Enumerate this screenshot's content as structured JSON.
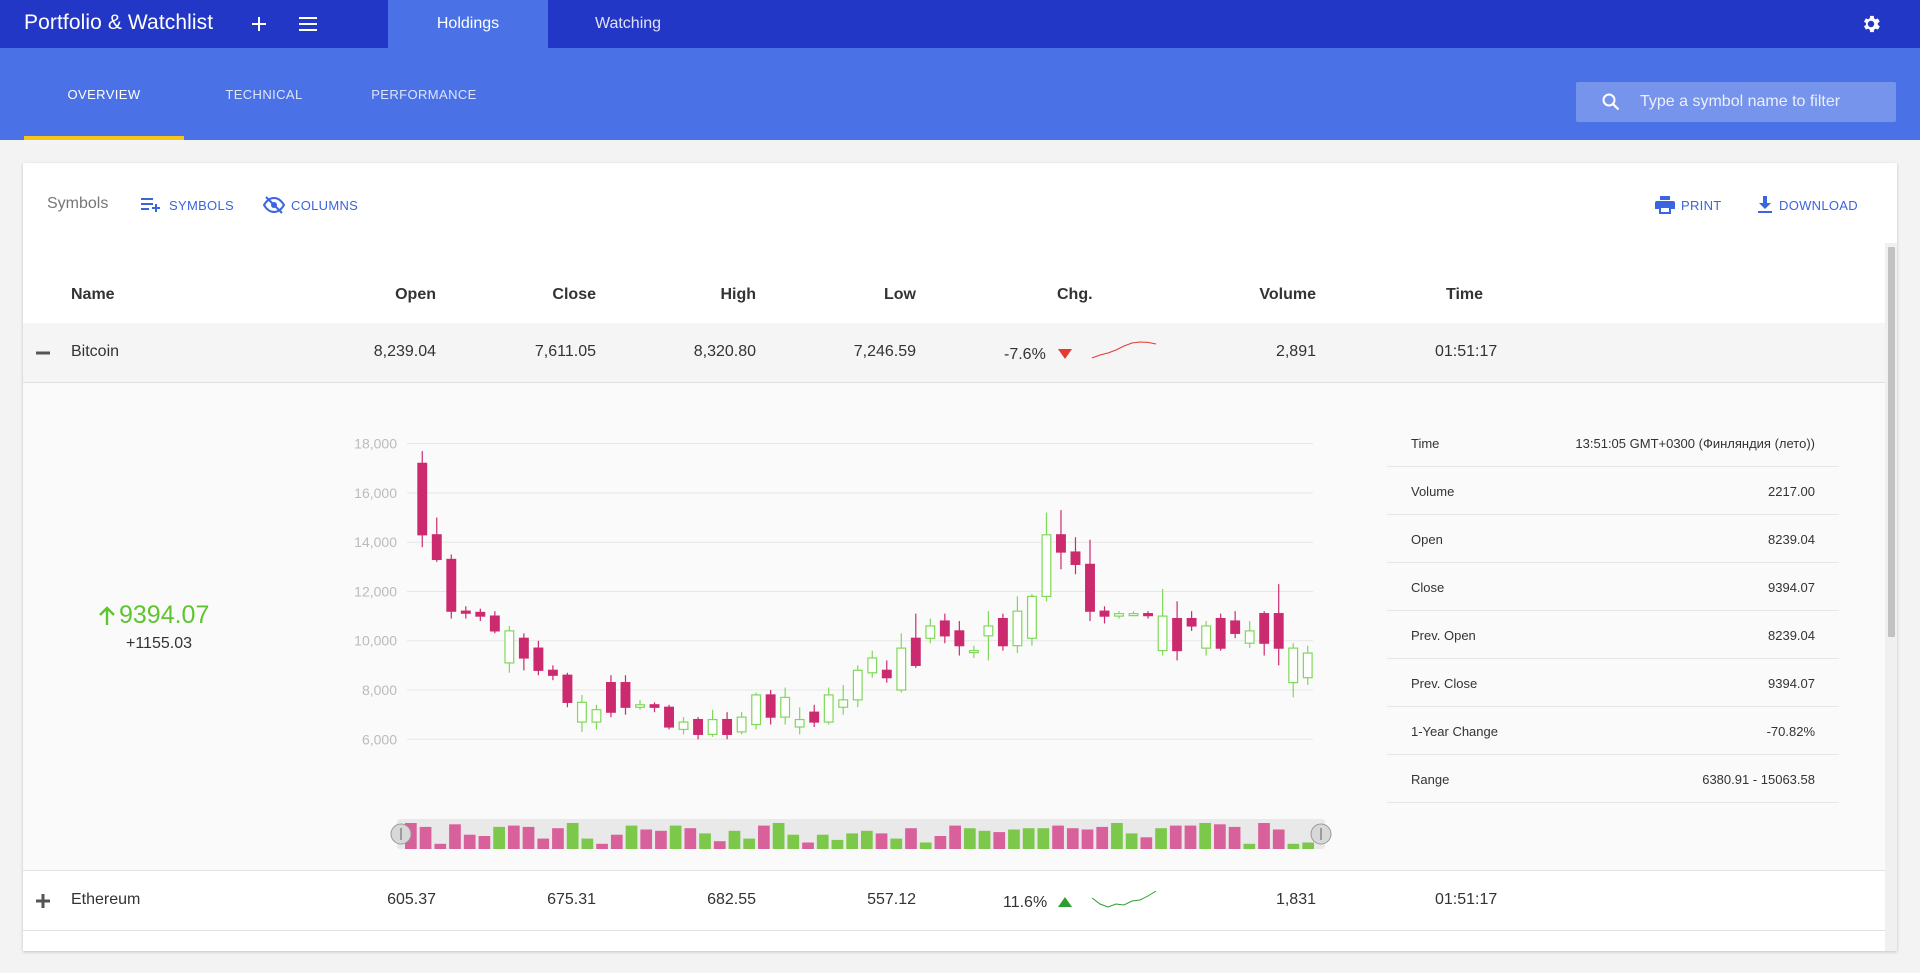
{
  "app": {
    "title": "Portfolio & Watchlist",
    "top_tabs": [
      {
        "label": "Holdings"
      },
      {
        "label": "Watching"
      }
    ],
    "sub_tabs": [
      {
        "label": "OVERVIEW"
      },
      {
        "label": "TECHNICAL"
      },
      {
        "label": "PERFORMANCE"
      }
    ],
    "search_placeholder": "Type a symbol name to filter"
  },
  "toolbar": {
    "label": "Symbols",
    "symbols_btn": "SYMBOLS",
    "columns_btn": "COLUMNS",
    "print_btn": "PRINT",
    "download_btn": "DOWNLOAD"
  },
  "grid": {
    "columns": [
      "Name",
      "Open",
      "Close",
      "High",
      "Low",
      "Chg.",
      "Volume",
      "Time"
    ],
    "rows": [
      {
        "name": "Bitcoin",
        "open": "8,239.04",
        "close": "7,611.05",
        "high": "8,320.80",
        "low": "7,246.59",
        "chg": "-7.6%",
        "direction": "down",
        "volume": "2,891",
        "time": "01:51:17",
        "expanded": true,
        "spark": [
          0.2,
          0.35,
          0.45,
          0.6,
          0.8,
          0.95,
          1.0,
          0.98,
          0.9
        ]
      },
      {
        "name": "Ethereum",
        "open": "605.37",
        "close": "675.31",
        "high": "682.55",
        "low": "557.12",
        "chg": "11.6%",
        "direction": "up",
        "volume": "1,831",
        "time": "01:51:17",
        "expanded": false,
        "spark": [
          0.6,
          0.3,
          0.15,
          0.3,
          0.25,
          0.45,
          0.5,
          0.7,
          0.95
        ]
      }
    ]
  },
  "detail": {
    "price": "9394.07",
    "change": "+1155.03",
    "info": [
      {
        "label": "Time",
        "value": "13:51:05 GMT+0300 (Финляндия (лето))"
      },
      {
        "label": "Volume",
        "value": "2217.00"
      },
      {
        "label": "Open",
        "value": "8239.04"
      },
      {
        "label": "Close",
        "value": "9394.07"
      },
      {
        "label": "Prev. Open",
        "value": "8239.04"
      },
      {
        "label": "Prev. Close",
        "value": "9394.07"
      },
      {
        "label": "1-Year Change",
        "value": "-70.82%"
      },
      {
        "label": "Range",
        "value": "6380.91 - 15063.58"
      }
    ]
  },
  "colors": {
    "up": "#7ed957",
    "down": "#cc2a6e",
    "accent": "#3a64e0",
    "vol_up": "#7cc84a",
    "vol_down": "#d9619b"
  },
  "chart_data": {
    "type": "candlestick",
    "y_ticks": [
      "18,000",
      "16,000",
      "14,000",
      "12,000",
      "10,000",
      "8,000",
      "6,000"
    ],
    "ylim": [
      5200,
      19000
    ],
    "candles": [
      [
        17200,
        14300,
        17700,
        13800
      ],
      [
        14300,
        13300,
        15000,
        13200
      ],
      [
        13300,
        11200,
        13500,
        10900
      ],
      [
        11200,
        11150,
        11400,
        10900
      ],
      [
        11150,
        11000,
        11300,
        10800
      ],
      [
        11000,
        10400,
        11200,
        10300
      ],
      [
        9100,
        10400,
        10600,
        8700
      ],
      [
        10100,
        9300,
        10300,
        8800
      ],
      [
        9700,
        8800,
        10000,
        8600
      ],
      [
        8800,
        8600,
        9000,
        8400
      ],
      [
        8600,
        7500,
        8700,
        7300
      ],
      [
        6700,
        7500,
        7800,
        6300
      ],
      [
        6700,
        7200,
        7400,
        6400
      ],
      [
        8300,
        7100,
        8600,
        6900
      ],
      [
        8300,
        7300,
        8600,
        7000
      ],
      [
        7300,
        7400,
        7600,
        7200
      ],
      [
        7400,
        7300,
        7500,
        7100
      ],
      [
        7300,
        6500,
        7400,
        6400
      ],
      [
        6400,
        6700,
        6900,
        6200
      ],
      [
        6800,
        6200,
        6900,
        6000
      ],
      [
        6200,
        6800,
        7200,
        6100
      ],
      [
        6800,
        6200,
        7100,
        6000
      ],
      [
        6300,
        6900,
        7100,
        6200
      ],
      [
        6600,
        7800,
        7900,
        6400
      ],
      [
        7800,
        6900,
        8000,
        6600
      ],
      [
        6900,
        7700,
        8100,
        6600
      ],
      [
        6500,
        6800,
        7300,
        6200
      ],
      [
        7100,
        6700,
        7400,
        6500
      ],
      [
        6700,
        7800,
        8100,
        6600
      ],
      [
        7300,
        7600,
        8200,
        7000
      ],
      [
        7600,
        8800,
        9000,
        7300
      ],
      [
        8700,
        9300,
        9600,
        8500
      ],
      [
        8800,
        8500,
        9200,
        8300
      ],
      [
        8000,
        9700,
        10300,
        7900
      ],
      [
        10100,
        9000,
        11100,
        8900
      ],
      [
        10100,
        10600,
        10900,
        9900
      ],
      [
        10800,
        10200,
        11100,
        9900
      ],
      [
        10400,
        9800,
        10800,
        9400
      ],
      [
        9600,
        9600,
        9800,
        9300
      ],
      [
        10200,
        10600,
        11200,
        9200
      ],
      [
        10900,
        9800,
        11100,
        9600
      ],
      [
        9800,
        11200,
        11800,
        9500
      ],
      [
        10100,
        11800,
        11900,
        9800
      ],
      [
        11800,
        14300,
        15200,
        11600
      ],
      [
        14300,
        13600,
        15300,
        12900
      ],
      [
        13600,
        13100,
        14200,
        12700
      ],
      [
        13100,
        11200,
        14100,
        10800
      ],
      [
        11200,
        11000,
        11400,
        10700
      ],
      [
        11000,
        11100,
        11200,
        10900
      ],
      [
        11100,
        11100,
        11200,
        11000
      ],
      [
        11100,
        11050,
        11200,
        10900
      ],
      [
        9600,
        11000,
        12100,
        9400
      ],
      [
        10900,
        9600,
        11600,
        9200
      ],
      [
        10900,
        10600,
        11200,
        10400
      ],
      [
        9700,
        10600,
        10800,
        9400
      ],
      [
        10900,
        9700,
        11100,
        9600
      ],
      [
        10800,
        10300,
        11200,
        10100
      ],
      [
        9900,
        10400,
        10800,
        9700
      ],
      [
        11100,
        9900,
        11200,
        9400
      ],
      [
        11100,
        9700,
        12300,
        9000
      ],
      [
        8300,
        9700,
        9900,
        7700
      ],
      [
        8500,
        9500,
        9800,
        8200
      ]
    ],
    "volume": [
      1.0,
      0.85,
      0.2,
      0.95,
      0.55,
      0.5,
      0.85,
      0.9,
      0.85,
      0.4,
      0.8,
      1.0,
      0.4,
      0.2,
      0.55,
      0.9,
      0.75,
      0.7,
      0.9,
      0.8,
      0.6,
      0.3,
      0.7,
      0.4,
      0.9,
      1.0,
      0.55,
      0.25,
      0.55,
      0.35,
      0.6,
      0.7,
      0.6,
      0.4,
      0.8,
      0.25,
      0.5,
      0.9,
      0.8,
      0.7,
      0.65,
      0.75,
      0.8,
      0.8,
      0.9,
      0.8,
      0.75,
      0.85,
      1.0,
      0.6,
      0.45,
      0.8,
      0.9,
      0.9,
      1.0,
      0.95,
      0.85,
      0.2,
      1.0,
      0.75,
      0.2,
      0.25
    ]
  }
}
